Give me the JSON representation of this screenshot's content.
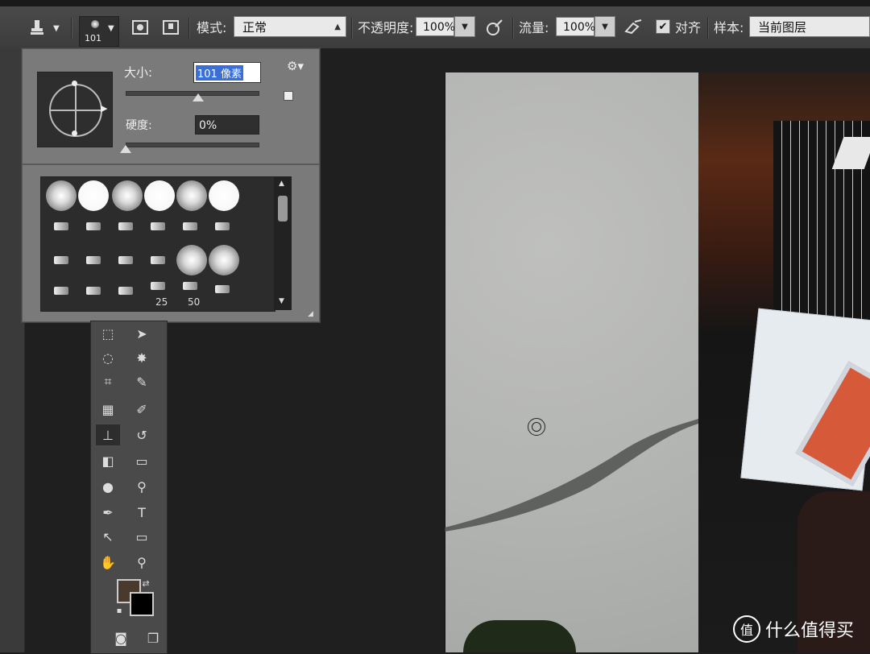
{
  "options_bar": {
    "brush_size": "101",
    "mode_label": "模式:",
    "mode_value": "正常",
    "opacity_label": "不透明度:",
    "opacity_value": "100%",
    "flow_label": "流量:",
    "flow_value": "100%",
    "align_label": "对齐",
    "sample_label": "样本:",
    "sample_value": "当前图层"
  },
  "brush_popup": {
    "size_label": "大小:",
    "size_value": "101 像素",
    "hardness_label": "硬度:",
    "hardness_value": "0%",
    "size_slider_value": 0.55,
    "hardness_slider_value": 0,
    "preset_labels": [
      "25",
      "50"
    ]
  },
  "watermark": {
    "text": "什么值得买",
    "logo": "值"
  },
  "colors": {
    "foreground": "#4a3a2e",
    "background": "#000000"
  },
  "icons": {
    "stamp": "clone-stamp-icon",
    "gear": "gear-icon",
    "airbrush": "airbrush-icon"
  }
}
